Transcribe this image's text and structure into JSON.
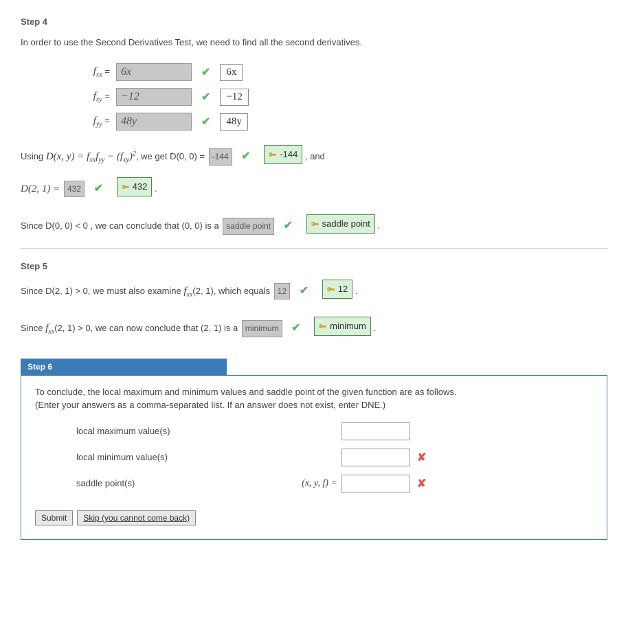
{
  "step4": {
    "title": "Step 4",
    "intro": "In order to use the Second Derivatives Test, we need to find all the second derivatives.",
    "rows": [
      {
        "label_var": "f",
        "label_sub": "xx",
        "input": "6x",
        "answer": "6x"
      },
      {
        "label_var": "f",
        "label_sub": "xy",
        "input": "−12",
        "answer": "−12"
      },
      {
        "label_var": "f",
        "label_sub": "yy",
        "input": "48y",
        "answer": "48y"
      }
    ],
    "line1_pre": "Using  ",
    "line1_d": "D(x, y) = f",
    "line1_sub1": "xx",
    "line1_f2": "f",
    "line1_sub2": "yy",
    "line1_minus": " − (f",
    "line1_sub3": "xy",
    "line1_paren": ")",
    "line1_sq": "2",
    "line1_post": ",  we get  D(0, 0) = ",
    "d00_input": "-144",
    "d00_key": "-144",
    "line1_and": ",   and",
    "line2_pre": "D(2, 1) = ",
    "d21_input": "432",
    "d21_key": "432",
    "line3_a": "Since  D(0, 0) < 0  , we can conclude that  (0, 0)  is a ",
    "d00_type_input": "saddle point",
    "d00_type_key": "saddle point"
  },
  "step5": {
    "title": "Step 5",
    "line1_a": "Since  D(2, 1) > 0,  we must also examine  ",
    "line1_f": "f",
    "line1_sub": "xx",
    "line1_b": "(2, 1),  which equals ",
    "fxx_input": "12",
    "fxx_key": "12",
    "line2_a": "Since  ",
    "line2_f": "f",
    "line2_sub": "xx",
    "line2_b": "(2, 1) > 0,  we can now conclude that (2, 1) is a ",
    "type_input": "minimum",
    "type_key": "minimum"
  },
  "step6": {
    "title": "Step 6",
    "intro1": "To conclude, the local maximum and minimum values and saddle point of the given function are as follows.",
    "intro2": "(Enter your answers as a comma-separated list. If an answer does not exist, enter DNE.)",
    "rows": [
      {
        "label": "local maximum value(s)",
        "prefix": "",
        "wrong": false
      },
      {
        "label": "local minimum value(s)",
        "prefix": "",
        "wrong": true
      },
      {
        "label": "saddle point(s)",
        "prefix": "(x, y, f)  =",
        "wrong": true
      }
    ],
    "submit": "Submit",
    "skip": "Skip (you cannot come back)"
  }
}
